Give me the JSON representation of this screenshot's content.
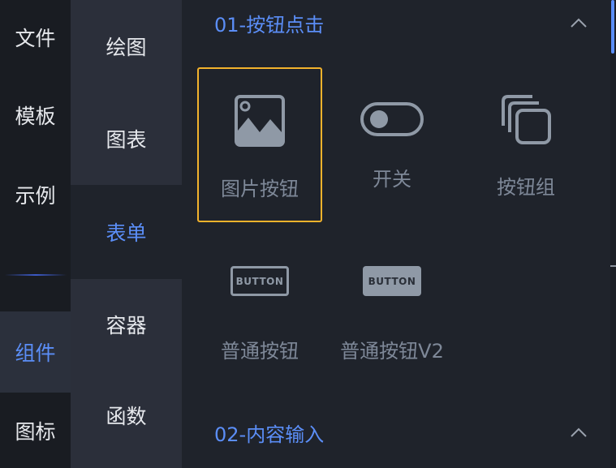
{
  "primary_nav": {
    "items": [
      {
        "label": "文件",
        "active": false
      },
      {
        "label": "模板",
        "active": false
      },
      {
        "label": "示例",
        "active": false
      },
      {
        "label": "组件",
        "active": true
      },
      {
        "label": "图标",
        "active": false
      }
    ]
  },
  "secondary_nav": {
    "items": [
      {
        "label": "绘图",
        "active": false
      },
      {
        "label": "图表",
        "active": false
      },
      {
        "label": "表单",
        "active": true
      },
      {
        "label": "容器",
        "active": false
      },
      {
        "label": "函数",
        "active": false
      }
    ]
  },
  "sections": [
    {
      "title": "01-按钮点击",
      "expanded": true,
      "items": [
        {
          "label": "图片按钮",
          "icon": "image-icon",
          "selected": true
        },
        {
          "label": "开关",
          "icon": "toggle-switch-icon",
          "selected": false
        },
        {
          "label": "按钮组",
          "icon": "stacked-squares-icon",
          "selected": false
        },
        {
          "label": "普通按钮",
          "icon": "button-outline-icon",
          "badge_text": "BUTTON",
          "selected": false
        },
        {
          "label": "普通按钮V2",
          "icon": "button-filled-icon",
          "badge_text": "BUTTON",
          "selected": false
        }
      ]
    },
    {
      "title": "02-内容输入",
      "expanded": true,
      "items": []
    }
  ],
  "colors": {
    "accent": "#5b8ef7",
    "selection_border": "#f2b22c",
    "icon_gray": "#8f99a6",
    "label_gray": "#7e8898"
  }
}
